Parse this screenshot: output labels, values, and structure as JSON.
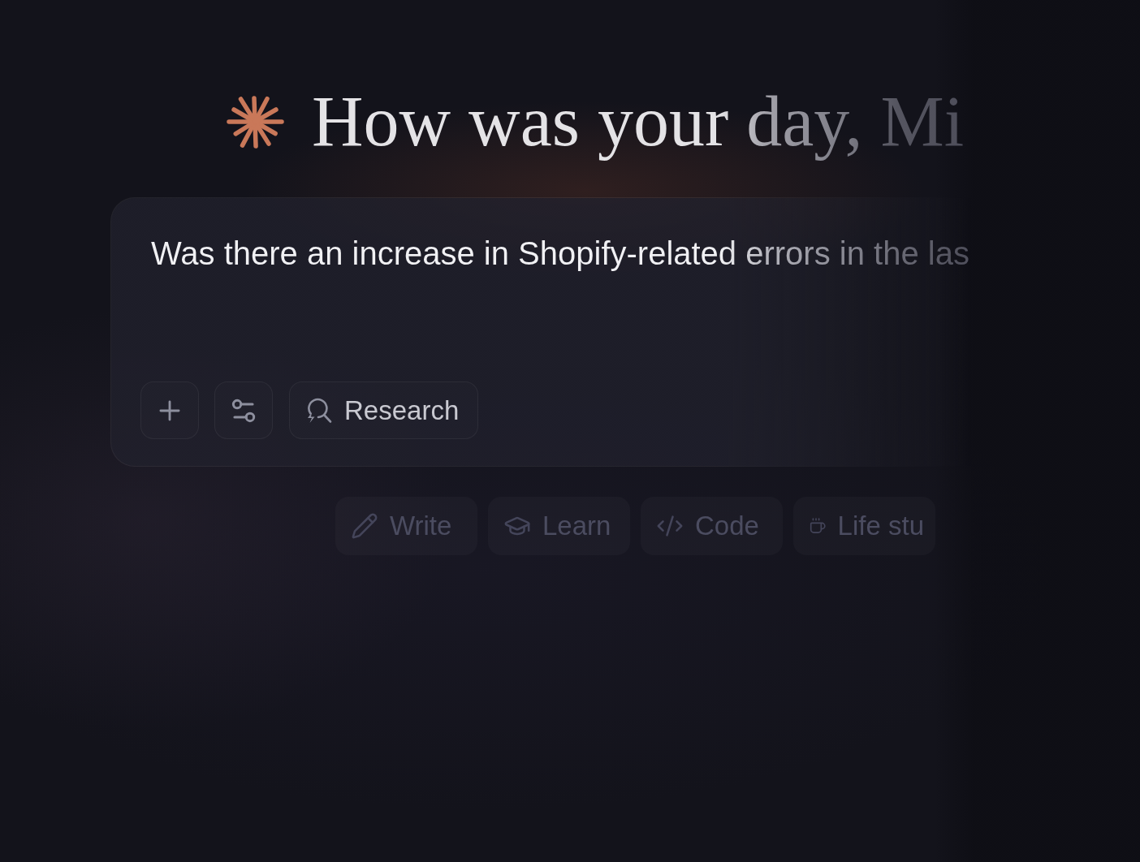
{
  "greeting": {
    "text": "How was your day, Mi"
  },
  "composer": {
    "value": "Was there an increase in Shopify-related errors in the las",
    "research_button": {
      "label": "Research"
    }
  },
  "suggestions": [
    {
      "label": "Write"
    },
    {
      "label": "Learn"
    },
    {
      "label": "Code"
    },
    {
      "label": "Life stu"
    }
  ]
}
